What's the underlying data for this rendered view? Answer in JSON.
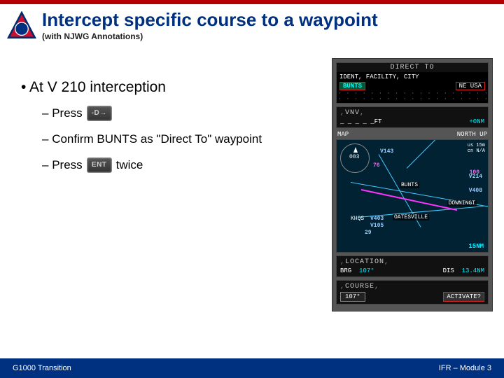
{
  "header": {
    "title": "Intercept specific course to a waypoint",
    "subtitle": "(with NJWG Annotations)"
  },
  "bullets": {
    "main": "At V 210 interception",
    "press": "Press",
    "confirm": "Confirm BUNTS as \"Direct To\" waypoint",
    "press2_prefix": "Press",
    "press2_suffix": "twice",
    "ent_label": "ENT",
    "dto_label": "-D→"
  },
  "screen": {
    "direct_to": "DIRECT TO",
    "ident_line": "IDENT, FACILITY, CITY",
    "waypoint": "BUNTS",
    "region": "NE USA",
    "vnv": "VNV",
    "vnv_ft": "_ _ _ _ _FT",
    "vnv_nm": "+0NM",
    "map_label": "MAP",
    "north_up": "NORTH UP",
    "range1": "us 15m",
    "range2": "cn N/A",
    "downingt": "DOWNINGT",
    "oatesville": "OATESVILLE",
    "location": "LOCATION",
    "brg_label": "BRG",
    "brg_val": "107°",
    "dis_label": "DIS",
    "dis_val": "13.4NM",
    "course_label": "COURSE",
    "course_val": "107°",
    "activate": "ACTIVATE?",
    "nm15": "15NM",
    "wp_bunts": "BUNTS",
    "aw_v143": "V143",
    "aw_v214": "V214",
    "aw_v408": "V408",
    "aw_v403": "V403",
    "aw_v105": "V105",
    "aw_29": "29",
    "heading": "003",
    "alt76": "76",
    "alt100": "100",
    "khqs": "KHQS"
  },
  "footer": {
    "left": "G1000 Transition",
    "right": "IFR – Module 3"
  }
}
